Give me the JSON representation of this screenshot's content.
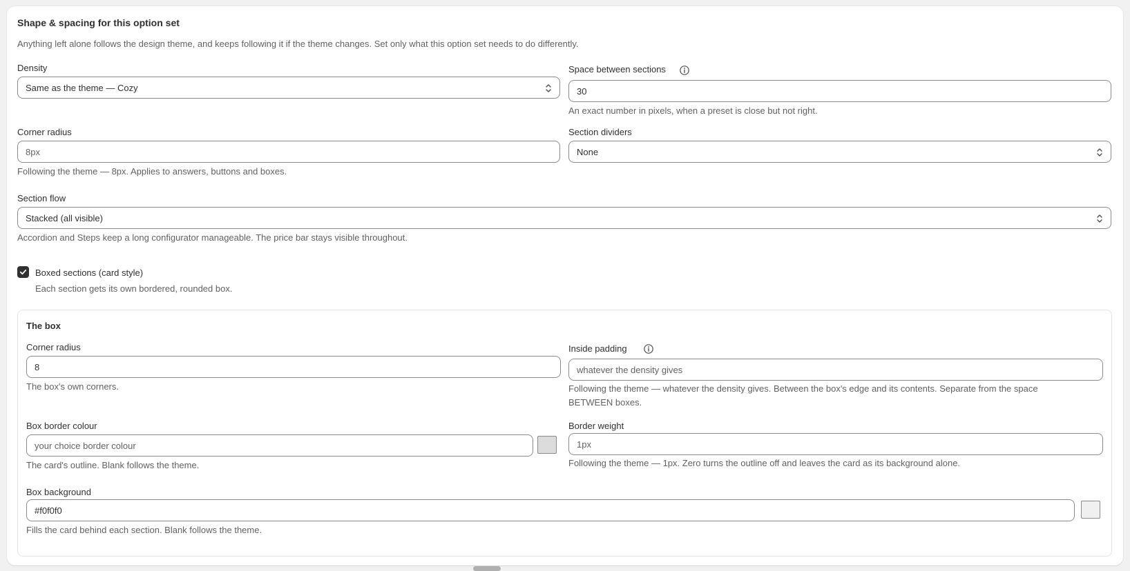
{
  "section": {
    "title": "Shape & spacing for this option set",
    "intro": "Anything left alone follows the design theme, and keeps following it if the theme changes. Set only what this option set needs to do differently."
  },
  "density": {
    "label": "Density",
    "value": "Same as the theme — Cozy"
  },
  "space_between": {
    "label": "Space between sections",
    "value": "30",
    "help": "An exact number in pixels, when a preset is close but not right."
  },
  "corner_radius": {
    "label": "Corner radius",
    "placeholder": "8px",
    "help": "Following the theme — 8px. Applies to answers, buttons and boxes."
  },
  "section_dividers": {
    "label": "Section dividers",
    "value": "None"
  },
  "section_flow": {
    "label": "Section flow",
    "value": "Stacked (all visible)",
    "help": "Accordion and Steps keep a long configurator manageable. The price bar stays visible throughout."
  },
  "boxed_sections": {
    "label": "Boxed sections (card style)",
    "checked": true,
    "help": "Each section gets its own bordered, rounded box."
  },
  "the_box": {
    "title": "The box",
    "corner_radius": {
      "label": "Corner radius",
      "value": "8",
      "help": "The box's own corners."
    },
    "inside_padding": {
      "label": "Inside padding",
      "placeholder": "whatever the density gives",
      "help_line1": "Following the theme — whatever the density gives. Between the box's edge and its contents. Separate from the space",
      "help_line2": "BETWEEN boxes."
    },
    "border_colour": {
      "label": "Box border colour",
      "placeholder": "your choice border colour",
      "help": "The card's outline. Blank follows the theme.",
      "swatch_color": "#dcdcdc"
    },
    "border_weight": {
      "label": "Border weight",
      "placeholder": "1px",
      "help": "Following the theme — 1px. Zero turns the outline off and leaves the card as its background alone."
    },
    "background": {
      "label": "Box background",
      "value": "#f0f0f0",
      "help": "Fills the card behind each section. Blank follows the theme.",
      "swatch_color": "#f0f0f0"
    }
  },
  "icons": {
    "info": "info-circle-icon",
    "chevron": "chevron-up-down-icon",
    "check": "checkmark-icon"
  }
}
